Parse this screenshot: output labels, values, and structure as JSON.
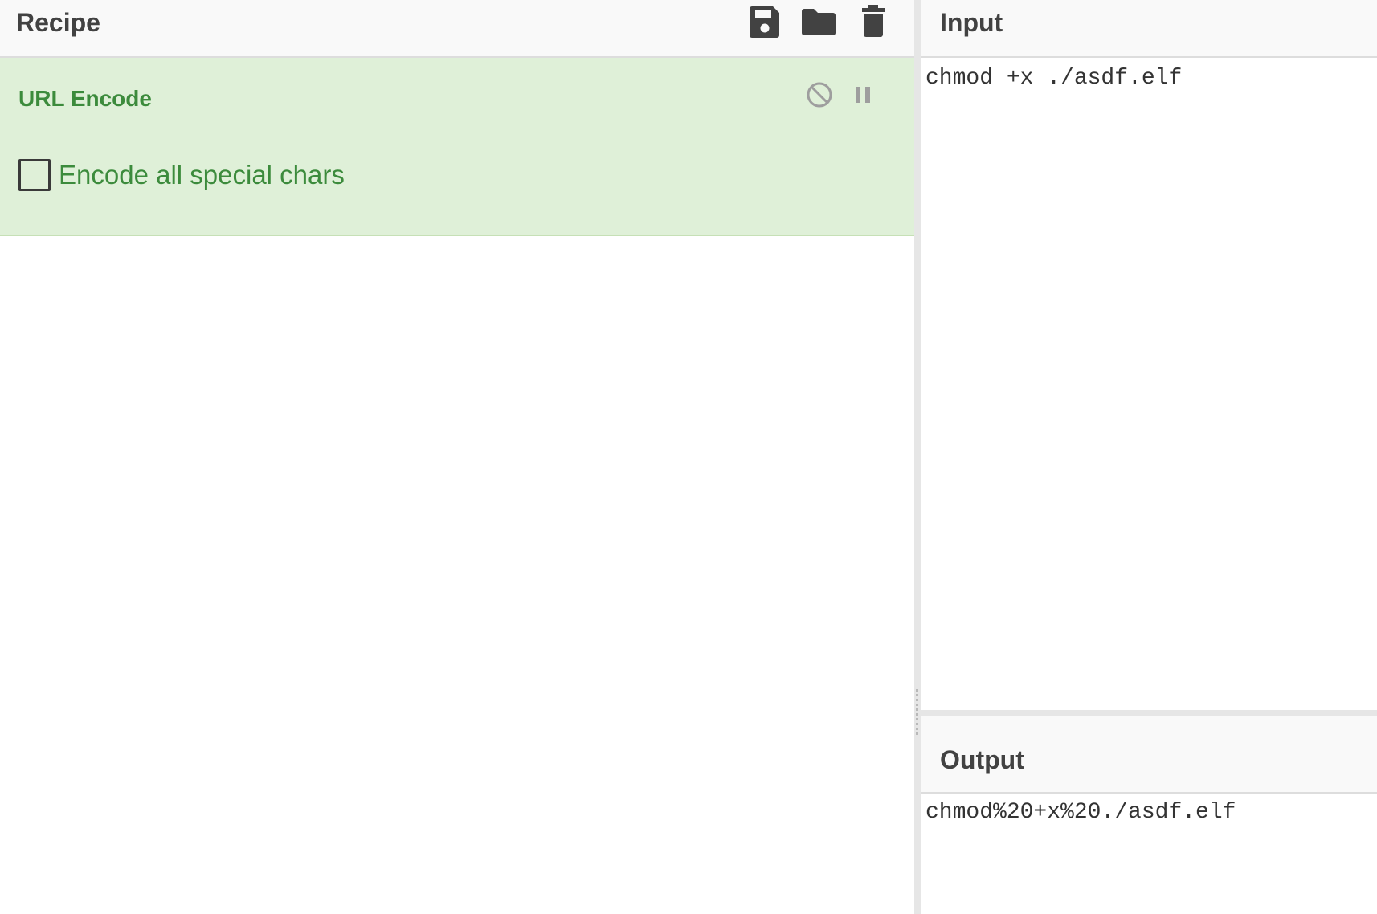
{
  "recipe": {
    "title": "Recipe",
    "toolbar": {
      "save_icon": "save-icon",
      "load_icon": "folder-icon",
      "clear_icon": "trash-icon"
    },
    "operation": {
      "name": "URL Encode",
      "disable_icon": "disable-icon",
      "breakpoint_icon": "pause-icon",
      "option": {
        "label": "Encode all special chars",
        "checked": false
      }
    }
  },
  "input": {
    "title": "Input",
    "value": "chmod +x ./asdf.elf"
  },
  "output": {
    "title": "Output",
    "value": "chmod%20+x%20./asdf.elf"
  },
  "colors": {
    "operation_bg": "#dff0d8",
    "operation_text": "#3c8b3c",
    "header_bg": "#f9f9f9",
    "icon_dark": "#424242",
    "icon_muted": "#9e9e9e"
  }
}
